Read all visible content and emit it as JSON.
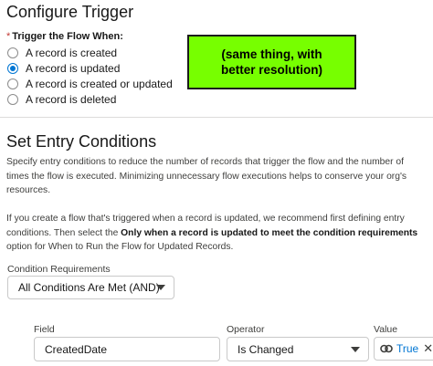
{
  "configure_trigger": {
    "title": "Configure Trigger",
    "asterisk": "*",
    "trigger_label": "Trigger the Flow When:",
    "options": [
      {
        "label": "A record is created",
        "checked": false
      },
      {
        "label": "A record is updated",
        "checked": true
      },
      {
        "label": "A record is created or updated",
        "checked": false
      },
      {
        "label": "A record is deleted",
        "checked": false
      }
    ]
  },
  "callout": {
    "line1": "(same thing, with",
    "line2": "better resolution)",
    "color": "#77ff00"
  },
  "entry_conditions": {
    "title": "Set Entry Conditions",
    "para1": "Specify entry conditions to reduce the number of records that trigger the flow and the number of times the flow is executed. Minimizing unnecessary flow executions helps to conserve your org's resources.",
    "para2_start": "If you create a flow that's triggered when a record is updated, we recommend first defining entry conditions. Then select the ",
    "para2_bold": "Only when a record is updated to meet the condition requirements",
    "para2_end": " option for When to Run the Flow for Updated Records.",
    "condition_requirements_label": "Condition Requirements",
    "condition_requirements_value": "All Conditions Are Met (AND)"
  },
  "condition_row": {
    "field_label": "Field",
    "field_value": "CreatedDate",
    "operator_label": "Operator",
    "operator_value": "Is Changed",
    "value_label": "Value",
    "value_value": "True",
    "value_icon": "link-icon",
    "remove_icon": "close-icon"
  },
  "colors": {
    "accent": "#0176d3",
    "required": "#c23934",
    "border": "#c9c9c9"
  }
}
